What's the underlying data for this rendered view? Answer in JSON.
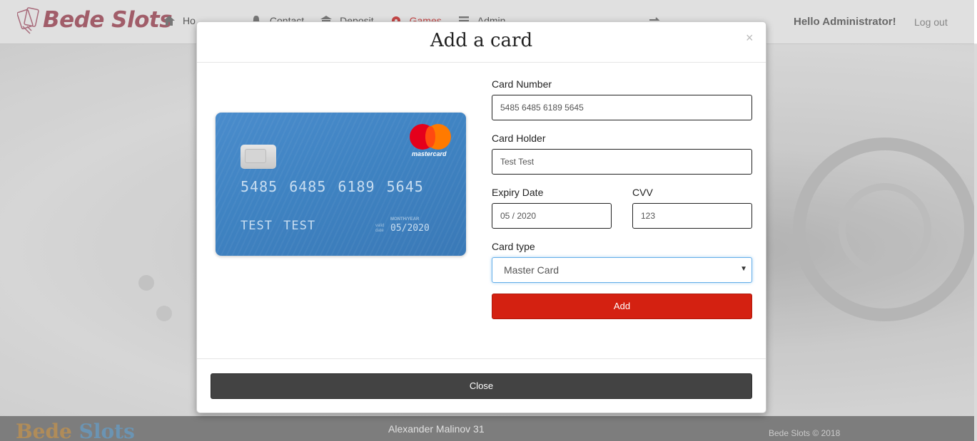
{
  "navbar": {
    "brand": "Bede Slots",
    "items": [
      {
        "label": "Ho",
        "icon": "home-icon"
      },
      {
        "label": "Contact",
        "icon": "bell-icon"
      },
      {
        "label": "Deposit",
        "icon": "bank-icon"
      },
      {
        "label": "Games",
        "icon": "gear-icon",
        "active": true
      },
      {
        "label": "Admin",
        "icon": "list-icon"
      }
    ],
    "greeting": "Hello Administrator!",
    "logout": "Log out"
  },
  "modal": {
    "title": "Add a card",
    "close_x": "×",
    "card_preview": {
      "number": "5485 6485 6189 5645",
      "holder": "TEST TEST",
      "month_year_label": "MONTH/YEAR",
      "valid_label": "valid date",
      "expiry": "05/2020",
      "brand": "mastercard"
    },
    "form": {
      "card_number_label": "Card Number",
      "card_number_value": "5485 6485 6189 5645",
      "card_holder_label": "Card Holder",
      "card_holder_value": "Test Test",
      "expiry_label": "Expiry Date",
      "expiry_value": "05 / 2020",
      "cvv_label": "CVV",
      "cvv_value": "123",
      "card_type_label": "Card type",
      "card_type_value": "Master Card",
      "add_label": "Add"
    },
    "close_label": "Close"
  },
  "footer": {
    "logo_word1": "Bede",
    "logo_word2": "Slots",
    "address": "Alexander Malinov 31",
    "copyright": "Bede Slots © 2018"
  },
  "colors": {
    "accent_red": "#d42111",
    "card_blue": "#3f83c2",
    "close_gray": "#434343"
  }
}
